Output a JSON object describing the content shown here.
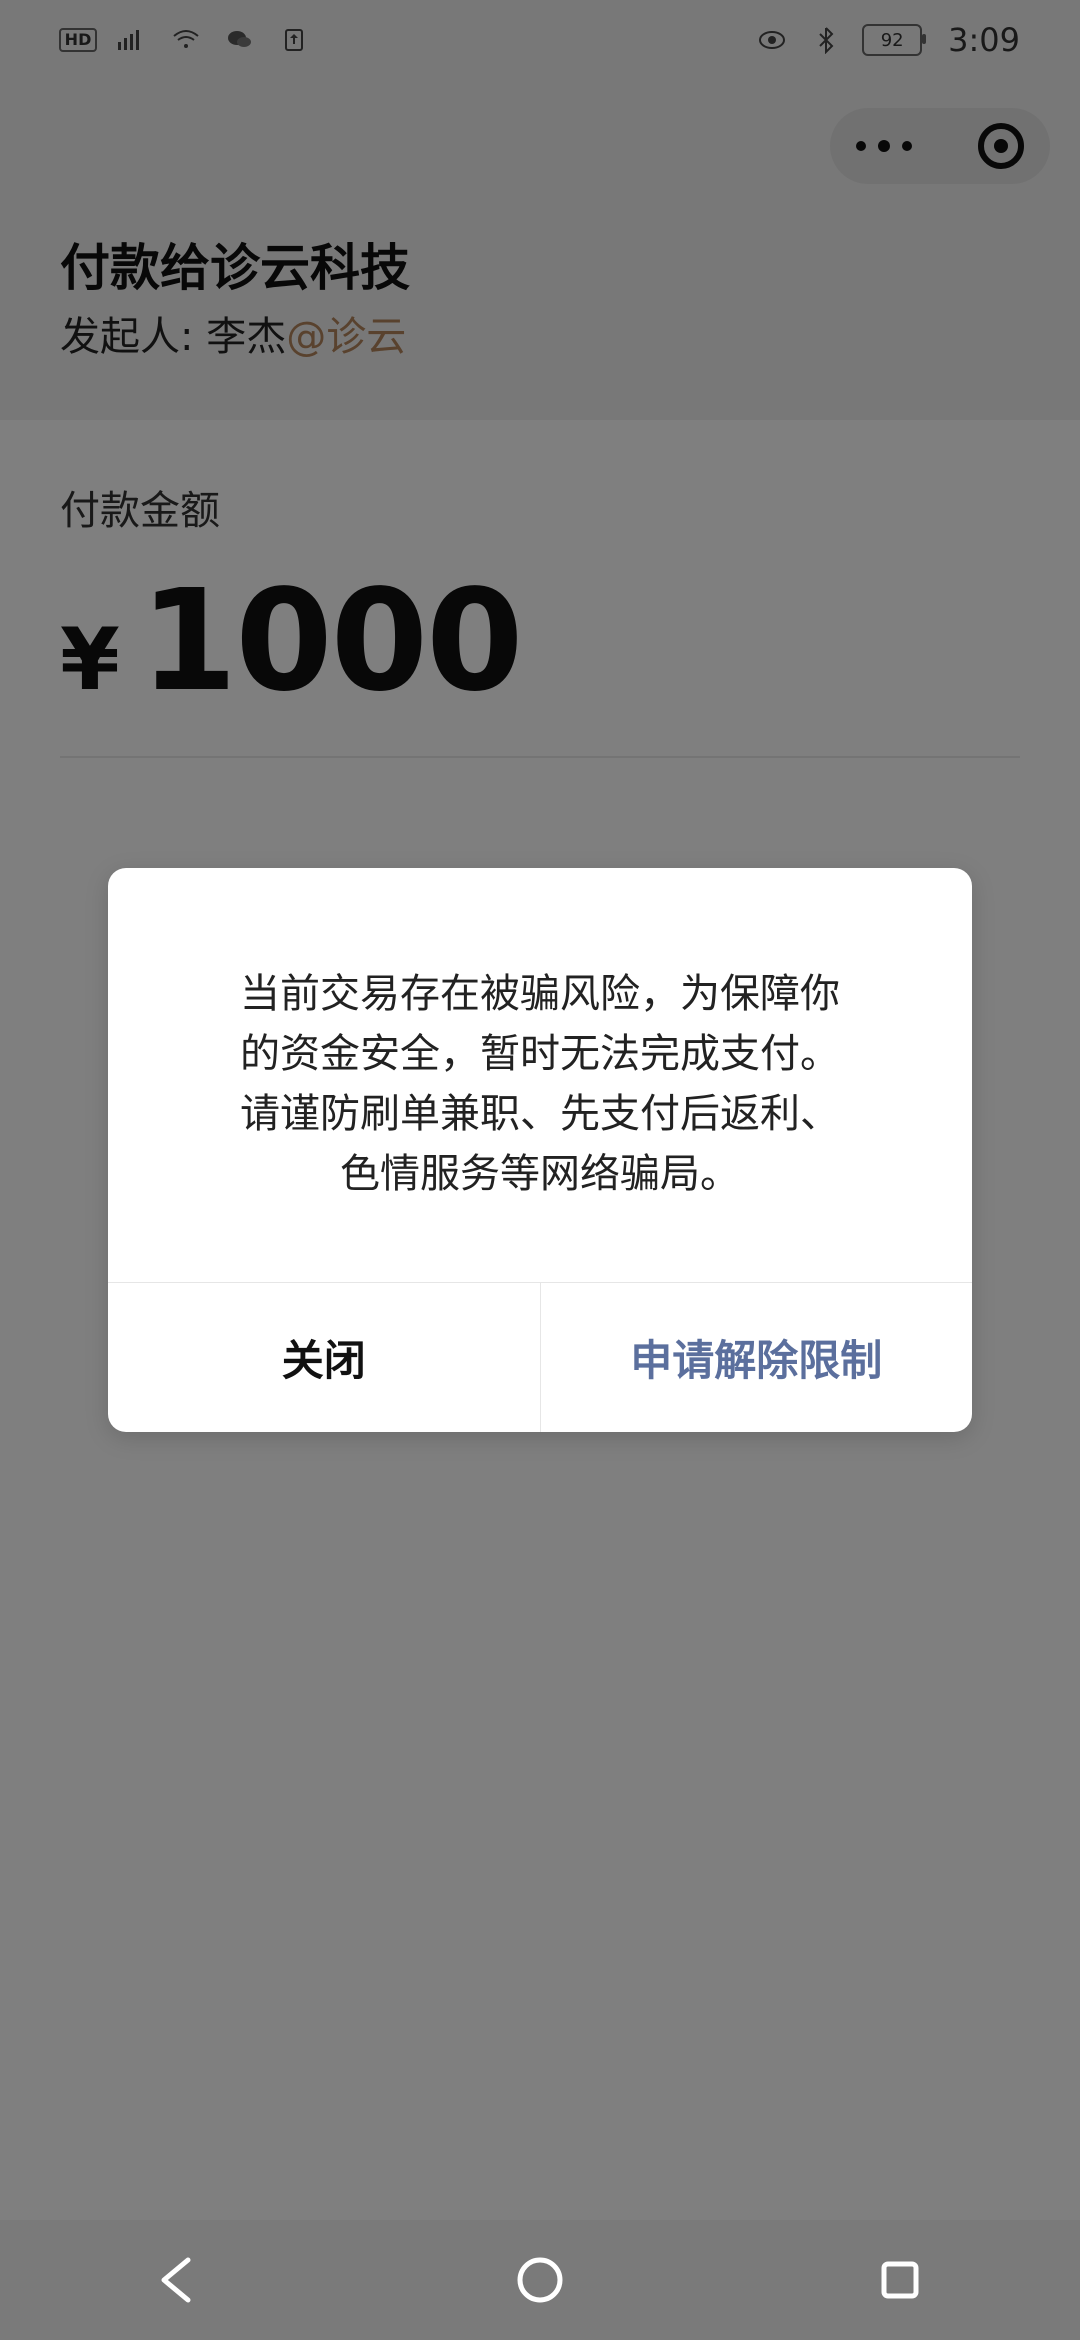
{
  "status_bar": {
    "time": "3:09",
    "battery_percent": "92",
    "icons": [
      "hd-icon",
      "4g-signal-icon",
      "wifi-icon",
      "wechat-icon",
      "upload-icon",
      "eye-icon",
      "bluetooth-icon",
      "battery-icon"
    ]
  },
  "header": {
    "title": "付款给诊云科技",
    "initiator_prefix": "发起人: 李杰",
    "initiator_org": "@诊云"
  },
  "amount": {
    "label": "付款金额",
    "currency": "¥",
    "value": "1000"
  },
  "dialog": {
    "message": "当前交易存在被骗风险，为保障你\n的资金安全，暂时无法完成支付。\n请谨防刷单兼职、先支付后返利、\n色情服务等网络骗局。",
    "buttons": {
      "close": "关闭",
      "request_unlock": "申请解除限制"
    }
  },
  "colors": {
    "accent_request": "#5b6f9d",
    "overlay": "rgba(0,0,0,0.5)",
    "nav_background": "#7a7a7a"
  }
}
